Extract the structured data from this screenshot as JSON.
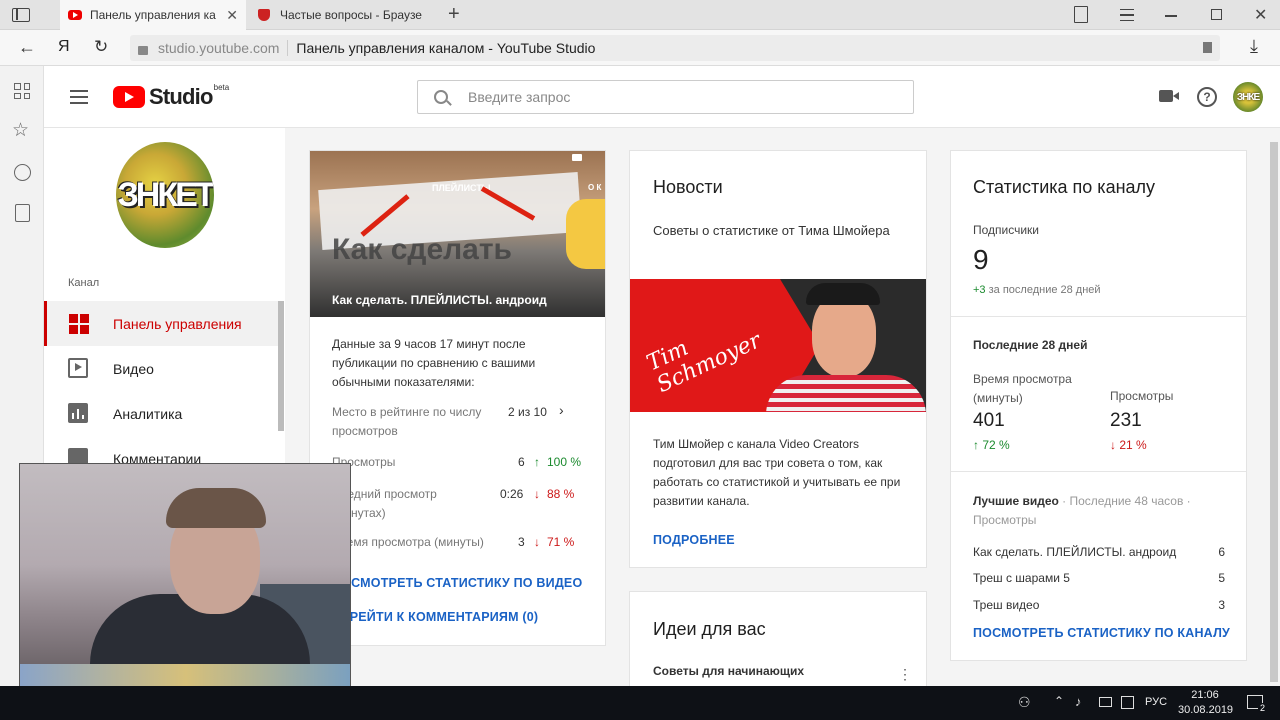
{
  "browser": {
    "tabs": [
      {
        "title": "Панель управления ка"
      },
      {
        "title": "Частые вопросы - Браузе"
      }
    ],
    "url_domain": "studio.youtube.com",
    "url_title": "Панель управления каналом - YouTube Studio",
    "yandex_letter": "Я"
  },
  "header": {
    "logo_text": "Studio",
    "logo_badge": "beta",
    "search_placeholder": "Введите запрос",
    "avatar_text": "ЗНКЕ"
  },
  "sidebar": {
    "avatar_text": "ЗНКЕТ",
    "section_label": "Канал",
    "items": [
      {
        "label": "Панель управления"
      },
      {
        "label": "Видео"
      },
      {
        "label": "Аналитика"
      },
      {
        "label": "Комментарии"
      }
    ]
  },
  "video_card": {
    "thumb_overlay_big": "Как сделать",
    "thumb_tag": "ПЛЕЙЛИСТЫ",
    "thumb_corner": "О К",
    "video_title": "Как сделать. ПЛЕЙЛИСТЫ. андроид",
    "description": "Данные за 9 часов 17 минут после публикации по сравнению с вашими обычными показателями:",
    "rows": [
      {
        "label": "Место в рейтинге по числу просмотров",
        "value": "2 из 10"
      },
      {
        "label": "Просмотры",
        "value": "6",
        "change": "100 %"
      },
      {
        "label": "Средний просмотр (минутах)",
        "value": "0:26",
        "change": "88 %"
      },
      {
        "label": "Время просмотра (минуты)",
        "value": "3",
        "change": "71 %"
      }
    ],
    "link_stats": "ПОСМОТРЕТЬ СТАТИСТИКУ ПО ВИДЕО",
    "link_comments": "ПЕРЕЙТИ К КОММЕНТАРИЯМ (0)"
  },
  "news_card": {
    "title": "Новости",
    "subtitle": "Советы о статистике от Тима Шмойера",
    "image_text": "Tim Schmoyer",
    "body": "Тим Шмойер с канала Video Creators подготовил для вас три совета о том, как работать со статистикой и учитывать ее при развитии канала.",
    "link": "ПОДРОБНЕЕ"
  },
  "ideas_card": {
    "title": "Идеи для вас",
    "subtitle": "Советы для начинающих"
  },
  "stats_card": {
    "title": "Статистика по каналу",
    "subs_label": "Подписчики",
    "subs_value": "9",
    "subs_change": "+3",
    "subs_period": "за последние 28 дней",
    "period_title": "Последние 28 дней",
    "watch_label": "Время просмотра (минуты)",
    "watch_value": "401",
    "watch_change": "72 %",
    "views_label": "Просмотры",
    "views_value": "231",
    "views_change": "21 %",
    "best_title": "Лучшие видео",
    "best_period": "· Последние 48 часов ·",
    "best_metric": "Просмотры",
    "best_videos": [
      {
        "title": "Как сделать. ПЛЕЙЛИСТЫ. андроид",
        "views": "6"
      },
      {
        "title": "Треш с шарами 5",
        "views": "5"
      },
      {
        "title": "Треш видео",
        "views": "3"
      }
    ],
    "link": "ПОСМОТРЕТЬ СТАТИСТИКУ ПО КАНАЛУ"
  },
  "taskbar": {
    "lang": "РУС",
    "time": "21:06",
    "date": "30.08.2019",
    "notif_count": "2"
  },
  "colors": {
    "accent_red": "#cc0000",
    "link_blue": "#1a62c5",
    "up_green": "#1b8a2e",
    "down_red": "#cc1818"
  }
}
